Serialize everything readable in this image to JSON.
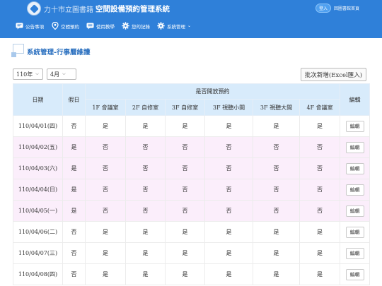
{
  "header": {
    "library_name": "力十市立圖書籍",
    "system_name": "空間設備預約管理系統",
    "login_label": "登入",
    "home_label": "回圖書館首頁",
    "nav": [
      {
        "label": "公告事項",
        "icon": "announcement-icon"
      },
      {
        "label": "空間預約",
        "icon": "location-pin-icon"
      },
      {
        "label": "使用教學",
        "icon": "tutorial-icon"
      },
      {
        "label": "您的記錄",
        "icon": "gear-icon"
      },
      {
        "label": "系統管理",
        "icon": "gear-icon",
        "has_dropdown": true
      }
    ]
  },
  "page": {
    "title": "系統管理-行事曆維護"
  },
  "filters": {
    "year": "110年",
    "month": "4月",
    "batch_button": "批次新增(Excel匯入)"
  },
  "table": {
    "col_date": "日期",
    "col_holiday": "假日",
    "col_open_group": "是否開放預約",
    "col_edit": "編輯",
    "rooms": [
      "1F 會議室",
      "2F 自修室",
      "3F 自修室",
      "3F 視聽小間",
      "3F 視聽大間",
      "4F 會議室"
    ],
    "edit_label": "編輯",
    "rows": [
      {
        "date": "110/04/01(四)",
        "holiday": "否",
        "open": [
          "是",
          "是",
          "是",
          "是",
          "是",
          "是"
        ]
      },
      {
        "date": "110/04/02(五)",
        "holiday": "是",
        "open": [
          "否",
          "否",
          "否",
          "否",
          "否",
          "否"
        ]
      },
      {
        "date": "110/04/03(六)",
        "holiday": "是",
        "open": [
          "否",
          "否",
          "否",
          "否",
          "否",
          "否"
        ]
      },
      {
        "date": "110/04/04(日)",
        "holiday": "是",
        "open": [
          "否",
          "否",
          "否",
          "否",
          "否",
          "否"
        ]
      },
      {
        "date": "110/04/05(一)",
        "holiday": "是",
        "open": [
          "否",
          "否",
          "否",
          "否",
          "否",
          "否"
        ]
      },
      {
        "date": "110/04/06(二)",
        "holiday": "否",
        "open": [
          "是",
          "是",
          "是",
          "是",
          "是",
          "是"
        ]
      },
      {
        "date": "110/04/07(三)",
        "holiday": "否",
        "open": [
          "是",
          "是",
          "是",
          "是",
          "是",
          "是"
        ]
      },
      {
        "date": "110/04/08(四)",
        "holiday": "否",
        "open": [
          "是",
          "是",
          "是",
          "是",
          "是",
          "是"
        ]
      }
    ]
  },
  "colors": {
    "header_bg": "#2f80d9",
    "table_header_bg": "#d8ebfb",
    "holiday_row_bg": "#fbeefb",
    "title_color": "#2a6fbf"
  }
}
